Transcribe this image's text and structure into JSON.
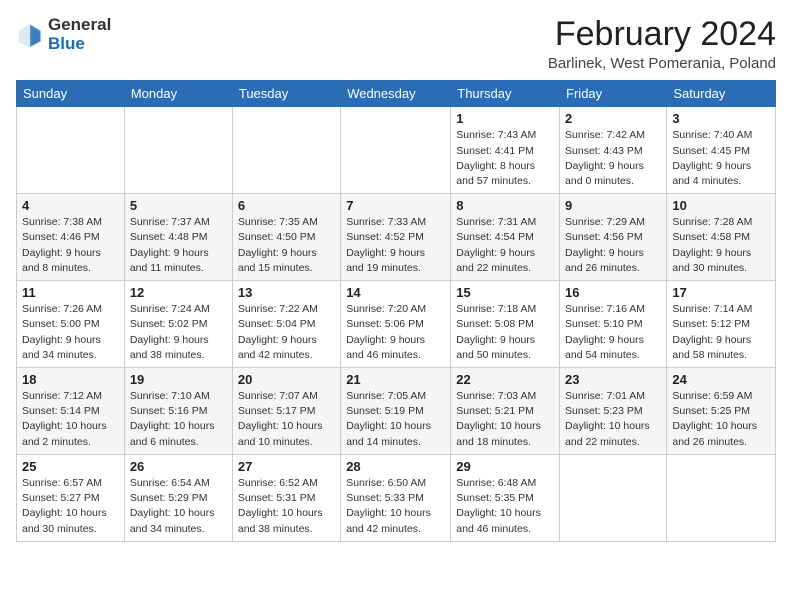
{
  "header": {
    "logo": {
      "general": "General",
      "blue": "Blue"
    },
    "title": "February 2024",
    "subtitle": "Barlinek, West Pomerania, Poland"
  },
  "weekdays": [
    "Sunday",
    "Monday",
    "Tuesday",
    "Wednesday",
    "Thursday",
    "Friday",
    "Saturday"
  ],
  "weeks": [
    [
      {
        "day": "",
        "info": ""
      },
      {
        "day": "",
        "info": ""
      },
      {
        "day": "",
        "info": ""
      },
      {
        "day": "",
        "info": ""
      },
      {
        "day": "1",
        "info": "Sunrise: 7:43 AM\nSunset: 4:41 PM\nDaylight: 8 hours\nand 57 minutes."
      },
      {
        "day": "2",
        "info": "Sunrise: 7:42 AM\nSunset: 4:43 PM\nDaylight: 9 hours\nand 0 minutes."
      },
      {
        "day": "3",
        "info": "Sunrise: 7:40 AM\nSunset: 4:45 PM\nDaylight: 9 hours\nand 4 minutes."
      }
    ],
    [
      {
        "day": "4",
        "info": "Sunrise: 7:38 AM\nSunset: 4:46 PM\nDaylight: 9 hours\nand 8 minutes."
      },
      {
        "day": "5",
        "info": "Sunrise: 7:37 AM\nSunset: 4:48 PM\nDaylight: 9 hours\nand 11 minutes."
      },
      {
        "day": "6",
        "info": "Sunrise: 7:35 AM\nSunset: 4:50 PM\nDaylight: 9 hours\nand 15 minutes."
      },
      {
        "day": "7",
        "info": "Sunrise: 7:33 AM\nSunset: 4:52 PM\nDaylight: 9 hours\nand 19 minutes."
      },
      {
        "day": "8",
        "info": "Sunrise: 7:31 AM\nSunset: 4:54 PM\nDaylight: 9 hours\nand 22 minutes."
      },
      {
        "day": "9",
        "info": "Sunrise: 7:29 AM\nSunset: 4:56 PM\nDaylight: 9 hours\nand 26 minutes."
      },
      {
        "day": "10",
        "info": "Sunrise: 7:28 AM\nSunset: 4:58 PM\nDaylight: 9 hours\nand 30 minutes."
      }
    ],
    [
      {
        "day": "11",
        "info": "Sunrise: 7:26 AM\nSunset: 5:00 PM\nDaylight: 9 hours\nand 34 minutes."
      },
      {
        "day": "12",
        "info": "Sunrise: 7:24 AM\nSunset: 5:02 PM\nDaylight: 9 hours\nand 38 minutes."
      },
      {
        "day": "13",
        "info": "Sunrise: 7:22 AM\nSunset: 5:04 PM\nDaylight: 9 hours\nand 42 minutes."
      },
      {
        "day": "14",
        "info": "Sunrise: 7:20 AM\nSunset: 5:06 PM\nDaylight: 9 hours\nand 46 minutes."
      },
      {
        "day": "15",
        "info": "Sunrise: 7:18 AM\nSunset: 5:08 PM\nDaylight: 9 hours\nand 50 minutes."
      },
      {
        "day": "16",
        "info": "Sunrise: 7:16 AM\nSunset: 5:10 PM\nDaylight: 9 hours\nand 54 minutes."
      },
      {
        "day": "17",
        "info": "Sunrise: 7:14 AM\nSunset: 5:12 PM\nDaylight: 9 hours\nand 58 minutes."
      }
    ],
    [
      {
        "day": "18",
        "info": "Sunrise: 7:12 AM\nSunset: 5:14 PM\nDaylight: 10 hours\nand 2 minutes."
      },
      {
        "day": "19",
        "info": "Sunrise: 7:10 AM\nSunset: 5:16 PM\nDaylight: 10 hours\nand 6 minutes."
      },
      {
        "day": "20",
        "info": "Sunrise: 7:07 AM\nSunset: 5:17 PM\nDaylight: 10 hours\nand 10 minutes."
      },
      {
        "day": "21",
        "info": "Sunrise: 7:05 AM\nSunset: 5:19 PM\nDaylight: 10 hours\nand 14 minutes."
      },
      {
        "day": "22",
        "info": "Sunrise: 7:03 AM\nSunset: 5:21 PM\nDaylight: 10 hours\nand 18 minutes."
      },
      {
        "day": "23",
        "info": "Sunrise: 7:01 AM\nSunset: 5:23 PM\nDaylight: 10 hours\nand 22 minutes."
      },
      {
        "day": "24",
        "info": "Sunrise: 6:59 AM\nSunset: 5:25 PM\nDaylight: 10 hours\nand 26 minutes."
      }
    ],
    [
      {
        "day": "25",
        "info": "Sunrise: 6:57 AM\nSunset: 5:27 PM\nDaylight: 10 hours\nand 30 minutes."
      },
      {
        "day": "26",
        "info": "Sunrise: 6:54 AM\nSunset: 5:29 PM\nDaylight: 10 hours\nand 34 minutes."
      },
      {
        "day": "27",
        "info": "Sunrise: 6:52 AM\nSunset: 5:31 PM\nDaylight: 10 hours\nand 38 minutes."
      },
      {
        "day": "28",
        "info": "Sunrise: 6:50 AM\nSunset: 5:33 PM\nDaylight: 10 hours\nand 42 minutes."
      },
      {
        "day": "29",
        "info": "Sunrise: 6:48 AM\nSunset: 5:35 PM\nDaylight: 10 hours\nand 46 minutes."
      },
      {
        "day": "",
        "info": ""
      },
      {
        "day": "",
        "info": ""
      }
    ]
  ]
}
